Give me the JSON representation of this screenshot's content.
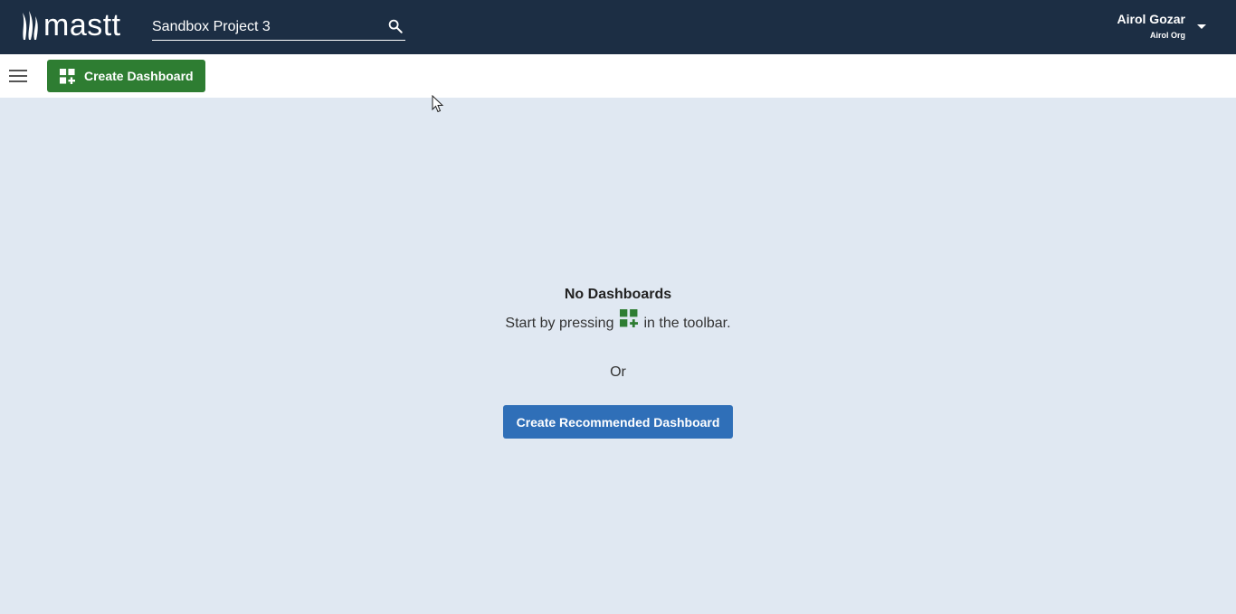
{
  "header": {
    "logo_text": "mastt",
    "search": {
      "value": "Sandbox Project 3",
      "placeholder": ""
    },
    "user": {
      "name": "Airol Gozar",
      "org": "Airol Org"
    }
  },
  "toolbar": {
    "create_dashboard_label": "Create Dashboard"
  },
  "empty_state": {
    "title": "No Dashboards",
    "hint_prefix": "Start by pressing",
    "hint_suffix": "in the toolbar.",
    "or_text": "Or",
    "recommended_button_label": "Create Recommended Dashboard"
  },
  "colors": {
    "header_bg": "#1c2e44",
    "primary_green": "#2e7d32",
    "primary_blue": "#2f6fb8",
    "page_bg": "#e0e8f2"
  },
  "icons": {
    "logo": "mastt-flame-logo",
    "search": "search-icon",
    "menu": "hamburger-menu-icon",
    "dropdown": "chevron-down-icon",
    "dashboard_add": "dashboard-add-icon"
  }
}
